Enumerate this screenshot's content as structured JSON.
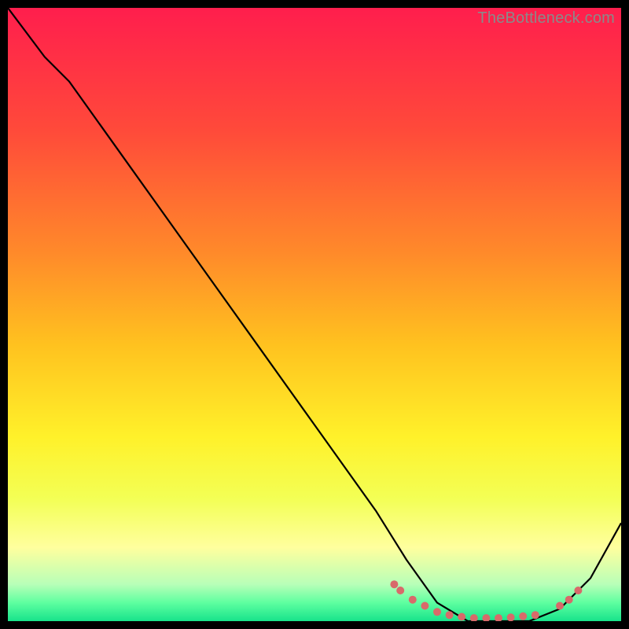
{
  "watermark": "TheBottleneck.com",
  "chart_data": {
    "type": "line",
    "title": "",
    "xlabel": "",
    "ylabel": "",
    "xlim": [
      0,
      100
    ],
    "ylim": [
      0,
      100
    ],
    "grid": false,
    "legend": false,
    "series": [
      {
        "name": "curve",
        "stroke": "#000000",
        "x": [
          0,
          6,
          10,
          20,
          30,
          40,
          50,
          60,
          65,
          70,
          75,
          80,
          85,
          90,
          95,
          100
        ],
        "y": [
          100,
          92,
          88,
          74,
          60,
          46,
          32,
          18,
          10,
          3,
          0,
          0,
          0,
          2,
          7,
          16
        ]
      }
    ],
    "markers": {
      "name": "flat-region-dots",
      "color": "#d86a6a",
      "x": [
        63,
        64,
        66,
        68,
        70,
        72,
        74,
        76,
        78,
        80,
        82,
        84,
        86,
        90,
        91.5,
        93
      ],
      "y": [
        6,
        5,
        3.5,
        2.5,
        1.5,
        1,
        0.7,
        0.5,
        0.5,
        0.5,
        0.6,
        0.8,
        1,
        2.5,
        3.5,
        5
      ]
    },
    "background_gradient": {
      "stops": [
        {
          "offset": 0.0,
          "color": "#ff1e4d"
        },
        {
          "offset": 0.2,
          "color": "#ff4a3a"
        },
        {
          "offset": 0.4,
          "color": "#ff8a2a"
        },
        {
          "offset": 0.55,
          "color": "#ffc21f"
        },
        {
          "offset": 0.7,
          "color": "#fff12a"
        },
        {
          "offset": 0.8,
          "color": "#f3ff55"
        },
        {
          "offset": 0.88,
          "color": "#ffff9e"
        },
        {
          "offset": 0.94,
          "color": "#b8ffb8"
        },
        {
          "offset": 0.97,
          "color": "#5effa0"
        },
        {
          "offset": 1.0,
          "color": "#17e38b"
        }
      ]
    }
  }
}
